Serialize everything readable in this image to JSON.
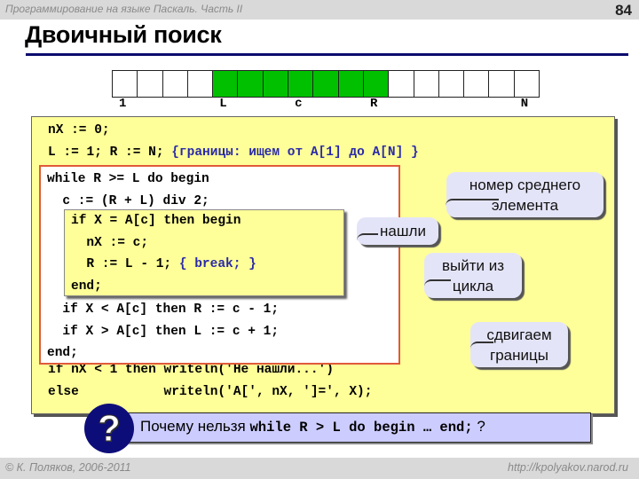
{
  "header": {
    "course": "Программирование на языке Паскаль. Часть II",
    "page_number": "84",
    "title": "Двоичный поиск"
  },
  "array_diagram": {
    "cell_count": 17,
    "highlight_from": 5,
    "highlight_to": 11,
    "highlight_color": "#00c000",
    "labels": [
      {
        "text": "1",
        "cell": 1
      },
      {
        "text": "L",
        "cell": 5
      },
      {
        "text": "c",
        "cell": 8
      },
      {
        "text": "R",
        "cell": 11
      },
      {
        "text": "N",
        "cell": 17
      }
    ]
  },
  "code": {
    "pre": [
      {
        "code": "nX := 0;",
        "comment": ""
      },
      {
        "code": "L := 1; R := N; ",
        "comment": "{границы: ищем от A[1] до A[N] }"
      }
    ],
    "loop_head": [
      {
        "code": "while R >= L do begin",
        "comment": ""
      },
      {
        "code": "  c := (R + L) div 2;",
        "comment": ""
      }
    ],
    "found_block": [
      {
        "code": "if X = A[c] then begin",
        "comment": ""
      },
      {
        "code": "  nX := c;",
        "comment": ""
      },
      {
        "code": "  R := L - 1; ",
        "comment": "{ break; }"
      },
      {
        "code": "end;",
        "comment": ""
      }
    ],
    "loop_tail": [
      {
        "code": "  if X < A[c] then R := c - 1;",
        "comment": ""
      },
      {
        "code": "  if X > A[c] then L := c + 1;",
        "comment": ""
      },
      {
        "code": "end;",
        "comment": ""
      }
    ],
    "post": [
      {
        "code": "if nX < 1 then writeln('Не нашли...')",
        "comment": ""
      },
      {
        "code": "else           writeln('A[', nX, ']=', X);",
        "comment": ""
      }
    ]
  },
  "callouts": {
    "middle": {
      "line1": "номер среднего",
      "line2": "элемента"
    },
    "found": {
      "line1": "нашли"
    },
    "exit": {
      "line1": "выйти из",
      "line2": "цикла"
    },
    "shift": {
      "line1": "сдвигаем",
      "line2": "границы"
    }
  },
  "question": {
    "icon": "question-mark-icon",
    "text_before": "Почему нельзя ",
    "code": "while R > L do begin … end;",
    "text_after": " ?"
  },
  "footer": {
    "copyright": "© К. Поляков, 2006-2011",
    "url": "http://kpolyakov.narod.ru"
  },
  "colors": {
    "code_box": "#ffff99",
    "loop_border": "#e05a3a",
    "comment": "#2a2aa8",
    "title_rule": "#0b0b6e",
    "callout": "#e4e4f8",
    "question_box": "#ccccff"
  }
}
